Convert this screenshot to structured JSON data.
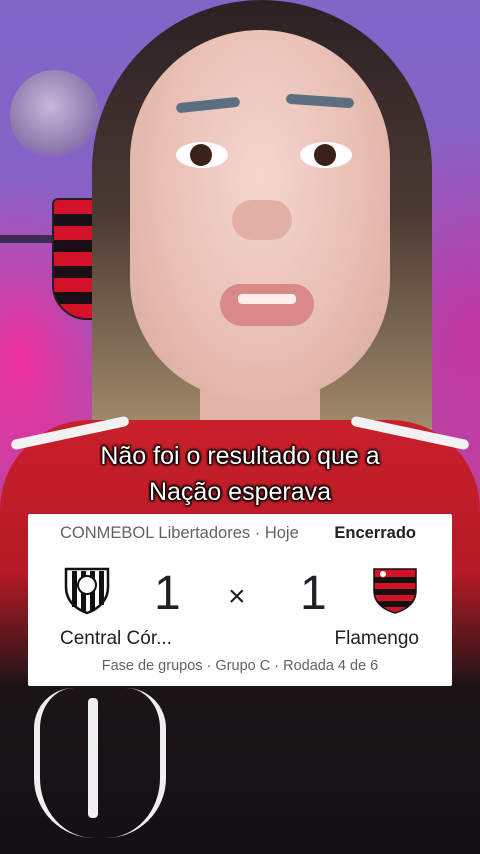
{
  "caption": {
    "line1": "Não foi o resultado que a",
    "line2": "Nação esperava"
  },
  "match_card": {
    "competition": "CONMEBOL Libertadores",
    "separator": "·",
    "day": "Hoje",
    "status": "Encerrado",
    "home_team": "Central Cór...",
    "away_team": "Flamengo",
    "home_score": "1",
    "away_score": "1",
    "score_separator": "×",
    "stage": "Fase de grupos · Grupo C · Rodada 4 de 6",
    "home_logo_icon": "central-cordoba-crest-icon",
    "away_logo_icon": "flamengo-crest-icon",
    "colors": {
      "flamengo_red": "#d3122a",
      "flamengo_black": "#111111",
      "muted_text": "#5f6368",
      "main_text": "#202124"
    }
  }
}
